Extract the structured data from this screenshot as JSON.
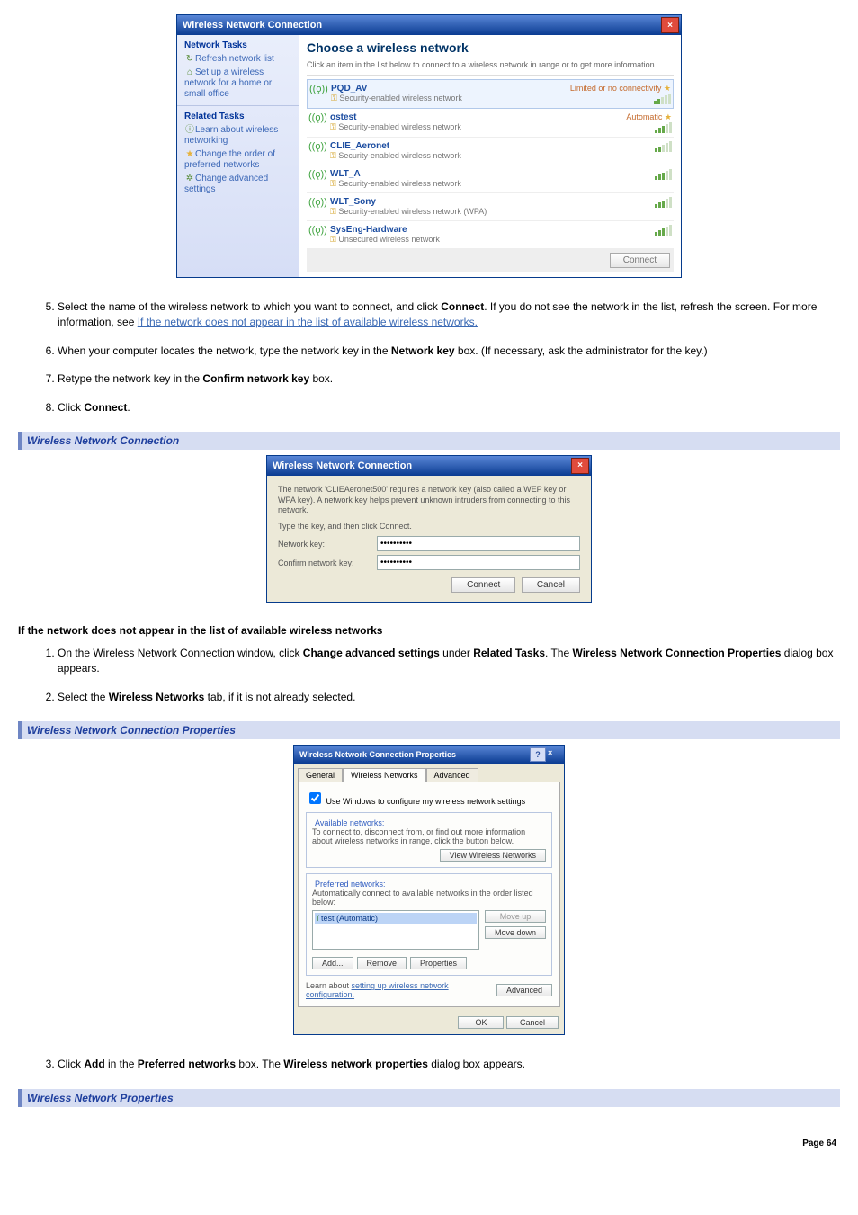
{
  "win1": {
    "title": "Wireless Network Connection",
    "heading": "Choose a wireless network",
    "blurb": "Click an item in the list below to connect to a wireless network in range or to get more information.",
    "side_tasks_hdr": "Network Tasks",
    "side_related_hdr": "Related Tasks",
    "tasks": [
      "Refresh network list",
      "Set up a wireless network for a home or small office"
    ],
    "related": [
      "Learn about wireless networking",
      "Change the order of preferred networks",
      "Change advanced settings"
    ],
    "nets": [
      {
        "name": "PQD_AV",
        "desc": "Security-enabled wireless network",
        "status": "Limited or no connectivity"
      },
      {
        "name": "ostest",
        "desc": "Security-enabled wireless network",
        "status": "Automatic"
      },
      {
        "name": "CLIE_Aeronet",
        "desc": "Security-enabled wireless network",
        "status": ""
      },
      {
        "name": "WLT_A",
        "desc": "Security-enabled wireless network",
        "status": ""
      },
      {
        "name": "WLT_Sony",
        "desc": "Security-enabled wireless network (WPA)",
        "status": ""
      },
      {
        "name": "SysEng-Hardware",
        "desc": "Unsecured wireless network",
        "status": ""
      }
    ],
    "connect_btn": "Connect"
  },
  "steps_a": [
    {
      "pre": "Select the name of the wireless network to which you want to connect, and click ",
      "b1": "Connect",
      "mid": ". If you do not see the network in the list, refresh the screen. For more information, see ",
      "link": "If the network does not appear in the list of available wireless networks."
    },
    {
      "pre": "When your computer locates the network, type the network key in the ",
      "b1": "Network key",
      "post": " box. (If necessary, ask the administrator for the key.)"
    },
    {
      "pre": "Retype the network key in the ",
      "b1": "Confirm network key",
      "post": " box."
    },
    {
      "pre": "Click ",
      "b1": "Connect",
      "post": "."
    }
  ],
  "hdr1": "Wireless Network Connection",
  "win2": {
    "title": "Wireless Network Connection",
    "msg": "The network 'CLIEAeronet500' requires a network key (also called a WEP key or WPA key). A network key helps prevent unknown intruders from connecting to this network.",
    "instr": "Type the key, and then click Connect.",
    "l1": "Network key:",
    "l2": "Confirm network key:",
    "v1": "••••••••••",
    "v2": "••••••••••",
    "connect": "Connect",
    "cancel": "Cancel"
  },
  "sect_bold": "If the network does not appear in the list of available wireless networks",
  "steps_b": [
    {
      "pre": "On the Wireless Network Connection window, click ",
      "b1": "Change advanced settings",
      "mid": " under ",
      "b2": "Related Tasks",
      "mid2": ". The ",
      "b3": "Wireless Network Connection Properties",
      "post": " dialog box appears."
    },
    {
      "pre": "Select the ",
      "b1": "Wireless Networks",
      "post": " tab, if it is not already selected."
    }
  ],
  "hdr2": "Wireless Network Connection Properties",
  "win3": {
    "title": "Wireless Network Connection Properties",
    "tabs": [
      "General",
      "Wireless Networks",
      "Advanced"
    ],
    "chk": "Use Windows to configure my wireless network settings",
    "avail_lbl": "Available networks:",
    "avail_txt": "To connect to, disconnect from, or find out more information about wireless networks in range, click the button below.",
    "view_btn": "View Wireless Networks",
    "pref_lbl": "Preferred networks:",
    "pref_txt": "Automatically connect to available networks in the order listed below:",
    "item": "test (Automatic)",
    "moveup": "Move up",
    "movedown": "Move down",
    "add": "Add...",
    "remove": "Remove",
    "props": "Properties",
    "learn": "Learn about ",
    "learn_link": "setting up wireless network configuration.",
    "adv": "Advanced",
    "ok": "OK",
    "cancel": "Cancel"
  },
  "steps_c": [
    {
      "pre": "Click ",
      "b1": "Add",
      "mid": " in the ",
      "b2": "Preferred networks",
      "mid2": " box. The ",
      "b3": "Wireless network properties",
      "post": " dialog box appears."
    }
  ],
  "hdr3": "Wireless Network Properties",
  "page_no": "Page 64"
}
